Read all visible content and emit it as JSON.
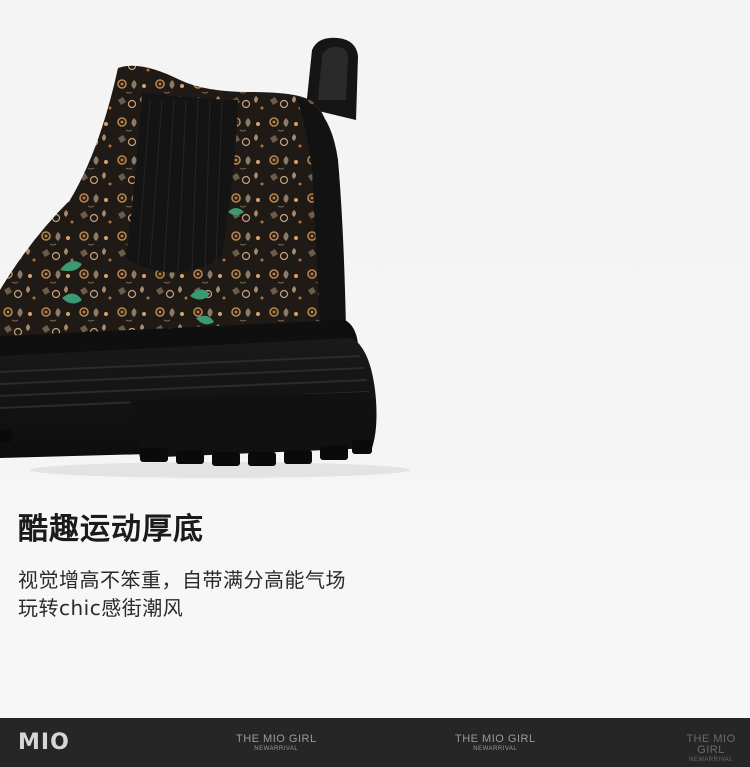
{
  "headline": "酷趣运动厚底",
  "description": {
    "line1": "视觉增高不笨重，自带满分高能气场",
    "line2": "玩转chic感街潮风"
  },
  "footer": {
    "brand": "MIO",
    "tags": [
      {
        "title": "THE MIO GIRL",
        "subtitle": "NEWARRIVAL"
      },
      {
        "title": "THE MIO GIRL",
        "subtitle": "NEWARRIVAL"
      },
      {
        "title": "THE MIO GIRL",
        "subtitle": "NEWARRIVAL"
      }
    ]
  },
  "colors": {
    "background": "#f7f7f7",
    "footer": "#262626",
    "headline": "#1b1b1b"
  }
}
